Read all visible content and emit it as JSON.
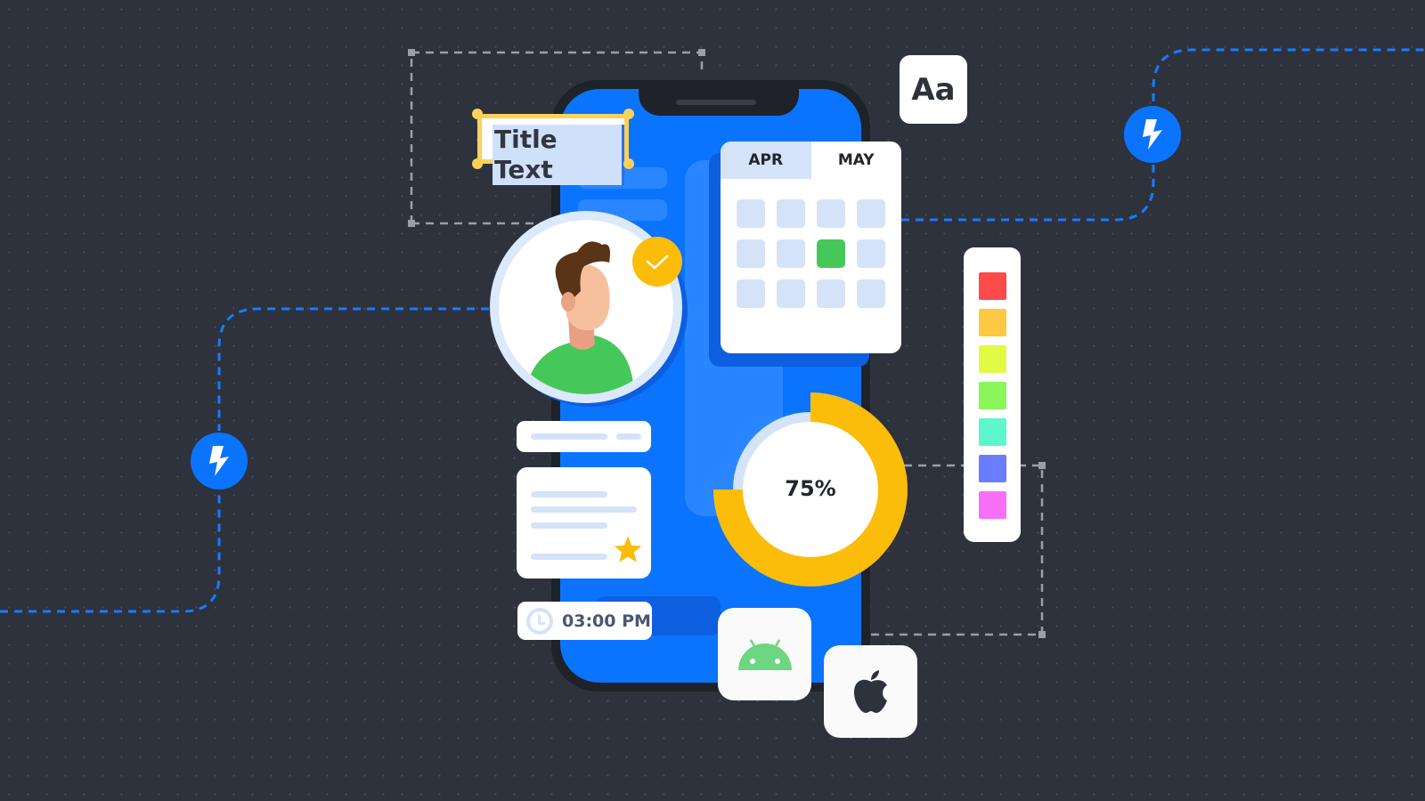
{
  "title_box": {
    "text": "Title Text"
  },
  "font_card": {
    "label": "Aa"
  },
  "calendar": {
    "tabs": [
      {
        "label": "APR",
        "active": true
      },
      {
        "label": "MAY",
        "active": false
      }
    ],
    "selected_cell": 6,
    "cell_count": 12
  },
  "progress": {
    "label": "75%",
    "value": 75
  },
  "time_pill": {
    "time": "03:00 PM",
    "icon": "clock-icon"
  },
  "palette": {
    "colors": [
      "#fd4a4a",
      "#fdc842",
      "#e1fb44",
      "#8cf55a",
      "#5ef6cd",
      "#6a7dff",
      "#f86ff7"
    ]
  },
  "platforms": [
    {
      "icon": "android-icon"
    },
    {
      "icon": "apple-icon"
    }
  ],
  "colors": {
    "background": "#2d323c",
    "screen": "#0a74ff",
    "accent": "#fbbc0a",
    "success": "#46c75a"
  }
}
